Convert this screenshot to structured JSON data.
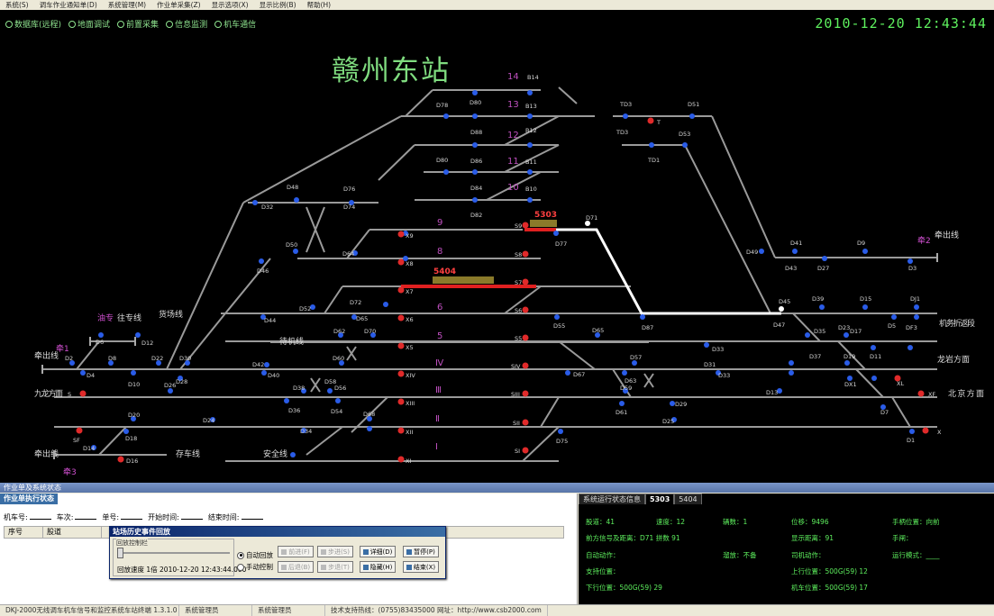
{
  "menu": [
    "系统(S)",
    "调车作业通知单(D)",
    "系统管理(M)",
    "作业单采集(Z)",
    "显示选项(X)",
    "显示比例(B)",
    "帮助(H)"
  ],
  "toolbar": [
    "数据库(远程)",
    "地面调试",
    "前置采集",
    "信息监测",
    "机车通信"
  ],
  "clock": "2010-12-20  12:43:44",
  "station_title": "赣州东站",
  "track_labels": {
    "t14": "14",
    "t13": "13",
    "t12": "12",
    "t11": "11",
    "t10": "10",
    "t9": "9",
    "t8": "8",
    "t7": "7",
    "t6": "6",
    "t5": "5",
    "tIV": "Ⅳ",
    "tIII": "Ⅲ",
    "tII": "Ⅱ",
    "tI": "Ⅰ"
  },
  "trains": {
    "a": "5303",
    "b": "5404"
  },
  "place_labels": {
    "qian1": "牵1",
    "qian2": "牵2",
    "qian3": "牵3",
    "you": "油专",
    "wangzhuan": "往专线",
    "huochang": "货场线",
    "qianchuxian": "牵出线",
    "qianchuxian2": "牵出线",
    "qianchu_r": "牵出线",
    "daiji": "待机线",
    "cunche": "存车线",
    "anquan": "安全线",
    "jiuwu": "九龙方面",
    "jiwu": "机务折返段",
    "longwu": "龙岩方面",
    "beijing": "北京方面"
  },
  "signals": {
    "D78": "D78",
    "D80": "D80",
    "D88": "D88",
    "B14": "B14",
    "B13": "B13",
    "B12": "B12",
    "B11": "B11",
    "B10": "B10",
    "D86": "D86",
    "D84": "D84",
    "D82": "D82",
    "D80b": "D80",
    "TD3": "TD3",
    "TD3b": "TD3",
    "T": "T",
    "D51": "D51",
    "D53": "D53",
    "TD1": "TD1",
    "D48": "D48",
    "D76": "D76",
    "D74": "D74",
    "D32": "D32",
    "D50": "D50",
    "D46": "D46",
    "D64": "D64",
    "X9": "X9",
    "X8": "X8",
    "X7": "X7",
    "X6": "X6",
    "X5": "X5",
    "X4": "XIV",
    "X3": "XIII",
    "X2": "XII",
    "X1": "XI",
    "S9": "S9",
    "S8": "S8",
    "S7": "S7",
    "S6": "S6",
    "S5": "S5",
    "S4": "SIV",
    "S3": "SIII",
    "S2": "SII",
    "S1": "SI",
    "D71": "D71",
    "D77": "D77",
    "D49": "D49",
    "D41": "D41",
    "D43": "D43",
    "D9": "D9",
    "D27": "D27",
    "D3": "D3",
    "D45": "D45",
    "D47": "D47",
    "D39": "D39",
    "D15": "D15",
    "DJ1": "DJ1",
    "D87": "D87",
    "D65": "D65",
    "D55": "D55",
    "D57": "D57",
    "D67": "D67",
    "D35": "D35",
    "D37": "D37",
    "D23": "D23",
    "D17": "D17",
    "D19": "D19",
    "D11": "D11",
    "D5": "D5",
    "DF3": "DF3",
    "D13": "D13",
    "D1": "D1",
    "D7": "D7",
    "X": "X",
    "XF": "XF",
    "XL": "XL",
    "DX1": "DX1",
    "D21": "D21",
    "D25": "D25",
    "D29": "D29",
    "D31": "D31",
    "D33": "D33",
    "D61": "D61",
    "D63": "D63",
    "D59": "D59",
    "D69": "D69",
    "D73": "D73",
    "D75": "D75",
    "D52": "D52",
    "D44": "D44",
    "D42": "D42",
    "D40": "D40",
    "D38": "D38",
    "D36": "D36",
    "D34": "D34",
    "D30": "D30",
    "D28": "D28",
    "D26": "D26",
    "D24": "D24",
    "D22": "D22",
    "D20": "D20",
    "D18": "D18",
    "D16": "D16",
    "D14": "D14",
    "D12": "D12",
    "D10": "D10",
    "D8": "D8",
    "D6": "D6",
    "D4": "D4",
    "D2": "D2",
    "S": "S",
    "SF": "SF",
    "D62": "D62",
    "D70": "D70",
    "D72": "D72",
    "D60": "D60",
    "D58": "D58",
    "D56": "D56",
    "D54": "D54",
    "D66": "D66",
    "D68": "D68",
    "D83": "D83",
    "D81": "D81",
    "D85": "D85",
    "D65b": "D65",
    "DF1": "DF1",
    "D89": "D89"
  },
  "bottom": {
    "panel_title": "作业单及系统状态",
    "left_tab": "作业单执行状态",
    "form": [
      "机车号:",
      "车次:",
      "单号:",
      "开始时间:",
      "结束时间:"
    ],
    "grid_cols": [
      "序号",
      "股道"
    ],
    "right_tabs": [
      "系统运行状态信息",
      "5303",
      "5404"
    ],
    "info": {
      "l1": "股道：41",
      "l2": "速度：12",
      "l3": "辆数：1",
      "l4": "位移：9496",
      "l5": "手柄位置：向前",
      "l6": "前方信号及距离：D71  拼数 91",
      "l7": "显示距离：91",
      "l8": "手闸：",
      "l9": "自动动作：",
      "l10": "溜放：不备",
      "l11": "司机动作：",
      "l12": "运行模式：____",
      "l13": "支持位置：",
      "l14": "上行位置：500G(59)  12",
      "l15": "下行位置：500G(59)  29",
      "l16": "机车位置：500G(59)  17"
    }
  },
  "dialog": {
    "title": "站场历史事件回放",
    "group": "回放控制栏",
    "speed": "回放速度  1倍  2010-12-20 12:43:44.000",
    "auto": "自动回放",
    "manual": "手动控制",
    "b_fwd": "前进(F)",
    "b_step": "步进(S)",
    "b_prev": "上一",
    "b_back": "后退(B)",
    "b_stepb": "步退(T)",
    "b_detail": "详细(D)",
    "b_pause": "暂停(P)",
    "b_hide": "隐藏(H)",
    "b_end": "结束(X)"
  },
  "status": [
    "DKJ-2000无线调车机车信号和监控系统车站终端 1.3.1.0",
    "系统管理员",
    "系统管理员",
    "技术支持热线：(0755)83435000 网址：http://www.csb2000.com"
  ]
}
